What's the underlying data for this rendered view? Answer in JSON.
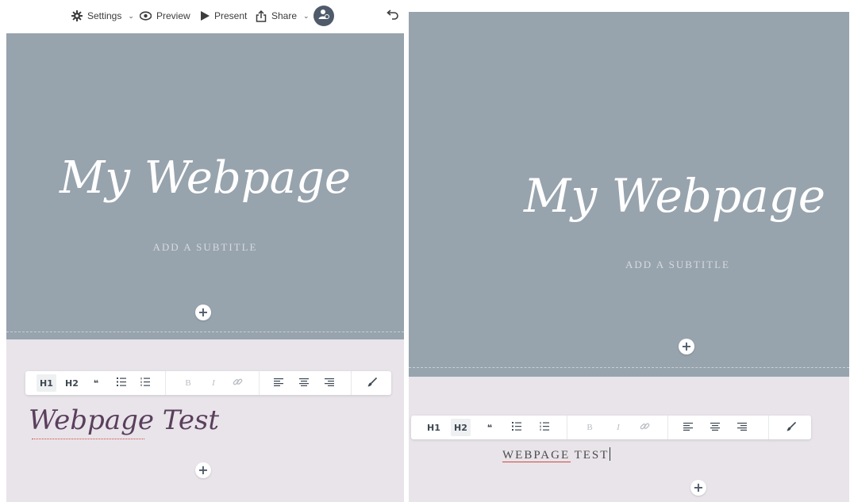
{
  "topbar": {
    "settings_label": "Settings",
    "preview_label": "Preview",
    "present_label": "Present",
    "share_label": "Share",
    "caret": "⌄"
  },
  "hero": {
    "title": "My Webpage",
    "subtitle": "ADD A SUBTITLE"
  },
  "toolbar": {
    "h1": "H1",
    "h2": "H2",
    "quote": "❝",
    "bold": "B",
    "italic": "I"
  },
  "left_panel": {
    "body_text": "Webpage Test",
    "active_style": "H1"
  },
  "right_panel": {
    "body_text_underlined": "WEBPAGE",
    "body_text_rest": " TEST",
    "active_style": "H2"
  },
  "colors": {
    "hero_bg": "#97a3ad",
    "lower_bg": "#e8e4ea",
    "accent_dark": "#4f5b6a",
    "script_text": "#5a3f5c",
    "spellcheck": "#d0463c"
  },
  "icons": {
    "settings": "gear-icon",
    "preview": "eye-icon",
    "present": "play-icon",
    "share": "share-icon",
    "avatar": "user-icon",
    "undo": "undo-icon",
    "add": "plus-icon",
    "brush": "brush-icon"
  }
}
